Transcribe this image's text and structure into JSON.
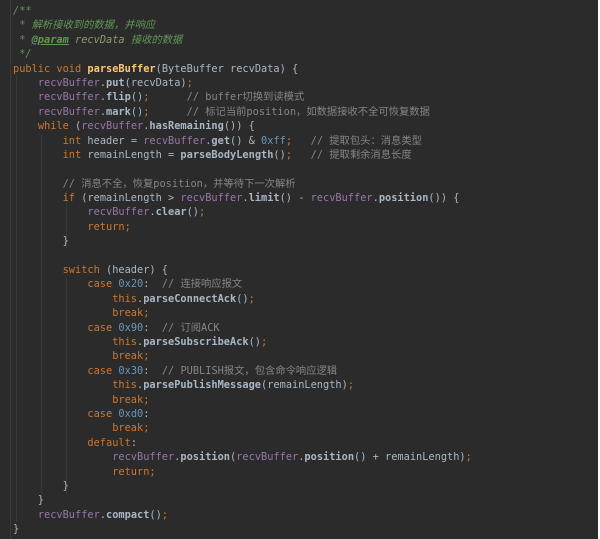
{
  "editor": {
    "palette": {
      "bg": "#2b2b2b",
      "gutterLine": "#3c3c3c",
      "guide": "#383838",
      "pln": "#a9b7c6",
      "kw": "#cc7832",
      "semi": "#cc7832",
      "meth": "#ffc66d",
      "call": "#a9b7c6",
      "field": "#9876aa",
      "num": "#6897bb",
      "cmt": "#858585",
      "doc": "#629755",
      "docval": "#8a9a70",
      "edge": "#ffffff"
    },
    "lines": [
      [
        [
          "doc",
          "/**"
        ]
      ],
      [
        [
          "doc",
          " * 解析接收到的数据，并响应"
        ]
      ],
      [
        [
          "doc",
          " * "
        ],
        [
          "doctag",
          "@param"
        ],
        [
          "doc",
          " "
        ],
        [
          "docval",
          "recvData"
        ],
        [
          "doc",
          " 接收的数据"
        ]
      ],
      [
        [
          "doc",
          " */"
        ]
      ],
      [
        [
          "kw",
          "public"
        ],
        [
          "pln",
          " "
        ],
        [
          "kw",
          "void"
        ],
        [
          "pln",
          " "
        ],
        [
          "meth",
          "parseBuffer"
        ],
        [
          "pln",
          "(ByteBuffer recvData) {"
        ]
      ],
      [
        [
          "pln",
          "    "
        ],
        [
          "field",
          "recvBuffer"
        ],
        [
          "pln",
          "."
        ],
        [
          "call",
          "put"
        ],
        [
          "pln",
          "(recvData)"
        ],
        [
          "semi",
          ";"
        ]
      ],
      [
        [
          "pln",
          "    "
        ],
        [
          "field",
          "recvBuffer"
        ],
        [
          "pln",
          "."
        ],
        [
          "call",
          "flip"
        ],
        [
          "pln",
          "()"
        ],
        [
          "semi",
          ";"
        ],
        [
          "pln",
          "      "
        ],
        [
          "cmt",
          "// buffer切换到读模式"
        ]
      ],
      [
        [
          "pln",
          "    "
        ],
        [
          "field",
          "recvBuffer"
        ],
        [
          "pln",
          "."
        ],
        [
          "call",
          "mark"
        ],
        [
          "pln",
          "()"
        ],
        [
          "semi",
          ";"
        ],
        [
          "pln",
          "      "
        ],
        [
          "cmt",
          "// 标记当前position，如数据接收不全可恢复数据"
        ]
      ],
      [
        [
          "pln",
          "    "
        ],
        [
          "kw",
          "while"
        ],
        [
          "pln",
          " ("
        ],
        [
          "field",
          "recvBuffer"
        ],
        [
          "pln",
          "."
        ],
        [
          "call",
          "hasRemaining"
        ],
        [
          "pln",
          "()) {"
        ]
      ],
      [
        [
          "pln",
          "        "
        ],
        [
          "kw",
          "int"
        ],
        [
          "pln",
          " header = "
        ],
        [
          "field",
          "recvBuffer"
        ],
        [
          "pln",
          "."
        ],
        [
          "call",
          "get"
        ],
        [
          "pln",
          "() & "
        ],
        [
          "num",
          "0xff"
        ],
        [
          "semi",
          ";"
        ],
        [
          "pln",
          "   "
        ],
        [
          "cmt",
          "// 提取包头：消息类型"
        ]
      ],
      [
        [
          "pln",
          "        "
        ],
        [
          "kw",
          "int"
        ],
        [
          "pln",
          " remainLength = "
        ],
        [
          "call",
          "parseBodyLength"
        ],
        [
          "pln",
          "()"
        ],
        [
          "semi",
          ";"
        ],
        [
          "pln",
          "   "
        ],
        [
          "cmt",
          "// 提取剩余消息长度"
        ]
      ],
      [],
      [
        [
          "pln",
          "        "
        ],
        [
          "cmt",
          "// 消息不全，恢复position，并等待下一次解析"
        ]
      ],
      [
        [
          "pln",
          "        "
        ],
        [
          "kw",
          "if"
        ],
        [
          "pln",
          " (remainLength > "
        ],
        [
          "field",
          "recvBuffer"
        ],
        [
          "pln",
          "."
        ],
        [
          "call",
          "limit"
        ],
        [
          "pln",
          "() - "
        ],
        [
          "field",
          "recvBuffer"
        ],
        [
          "pln",
          "."
        ],
        [
          "call",
          "position"
        ],
        [
          "pln",
          "()) {"
        ]
      ],
      [
        [
          "pln",
          "            "
        ],
        [
          "field",
          "recvBuffer"
        ],
        [
          "pln",
          "."
        ],
        [
          "call",
          "clear"
        ],
        [
          "pln",
          "()"
        ],
        [
          "semi",
          ";"
        ]
      ],
      [
        [
          "pln",
          "            "
        ],
        [
          "kw",
          "return"
        ],
        [
          "semi",
          ";"
        ]
      ],
      [
        [
          "pln",
          "        }"
        ]
      ],
      [],
      [
        [
          "pln",
          "        "
        ],
        [
          "kw",
          "switch"
        ],
        [
          "pln",
          " (header) {"
        ]
      ],
      [
        [
          "pln",
          "            "
        ],
        [
          "kw",
          "case"
        ],
        [
          "pln",
          " "
        ],
        [
          "num",
          "0x20"
        ],
        [
          "pln",
          ":  "
        ],
        [
          "cmt",
          "// 连接响应报文"
        ]
      ],
      [
        [
          "pln",
          "                "
        ],
        [
          "kw",
          "this"
        ],
        [
          "pln",
          "."
        ],
        [
          "call",
          "parseConnectAck"
        ],
        [
          "pln",
          "()"
        ],
        [
          "semi",
          ";"
        ]
      ],
      [
        [
          "pln",
          "                "
        ],
        [
          "kw",
          "break"
        ],
        [
          "semi",
          ";"
        ]
      ],
      [
        [
          "pln",
          "            "
        ],
        [
          "kw",
          "case"
        ],
        [
          "pln",
          " "
        ],
        [
          "num",
          "0x90"
        ],
        [
          "pln",
          ":  "
        ],
        [
          "cmt",
          "// 订阅ACK"
        ]
      ],
      [
        [
          "pln",
          "                "
        ],
        [
          "kw",
          "this"
        ],
        [
          "pln",
          "."
        ],
        [
          "call",
          "parseSubscribeAck"
        ],
        [
          "pln",
          "()"
        ],
        [
          "semi",
          ";"
        ]
      ],
      [
        [
          "pln",
          "                "
        ],
        [
          "kw",
          "break"
        ],
        [
          "semi",
          ";"
        ]
      ],
      [
        [
          "pln",
          "            "
        ],
        [
          "kw",
          "case"
        ],
        [
          "pln",
          " "
        ],
        [
          "num",
          "0x30"
        ],
        [
          "pln",
          ":  "
        ],
        [
          "cmt",
          "// PUBLISH报文，包含命令响应逻辑"
        ]
      ],
      [
        [
          "pln",
          "                "
        ],
        [
          "kw",
          "this"
        ],
        [
          "pln",
          "."
        ],
        [
          "call",
          "parsePublishMessage"
        ],
        [
          "pln",
          "(remainLength)"
        ],
        [
          "semi",
          ";"
        ]
      ],
      [
        [
          "pln",
          "                "
        ],
        [
          "kw",
          "break"
        ],
        [
          "semi",
          ";"
        ]
      ],
      [
        [
          "pln",
          "            "
        ],
        [
          "kw",
          "case"
        ],
        [
          "pln",
          " "
        ],
        [
          "num",
          "0xd0"
        ],
        [
          "pln",
          ":"
        ]
      ],
      [
        [
          "pln",
          "                "
        ],
        [
          "kw",
          "break"
        ],
        [
          "semi",
          ";"
        ]
      ],
      [
        [
          "pln",
          "            "
        ],
        [
          "kw",
          "default"
        ],
        [
          "pln",
          ":"
        ]
      ],
      [
        [
          "pln",
          "                "
        ],
        [
          "field",
          "recvBuffer"
        ],
        [
          "pln",
          "."
        ],
        [
          "call",
          "position"
        ],
        [
          "pln",
          "("
        ],
        [
          "field",
          "recvBuffer"
        ],
        [
          "pln",
          "."
        ],
        [
          "call",
          "position"
        ],
        [
          "pln",
          "() + remainLength)"
        ],
        [
          "semi",
          ";"
        ]
      ],
      [
        [
          "pln",
          "                "
        ],
        [
          "kw",
          "return"
        ],
        [
          "semi",
          ";"
        ]
      ],
      [
        [
          "pln",
          "        }"
        ]
      ],
      [
        [
          "pln",
          "    }"
        ]
      ],
      [
        [
          "pln",
          "    "
        ],
        [
          "field",
          "recvBuffer"
        ],
        [
          "pln",
          "."
        ],
        [
          "call",
          "compact"
        ],
        [
          "pln",
          "()"
        ],
        [
          "semi",
          ";"
        ]
      ],
      [
        [
          "pln",
          "}"
        ]
      ]
    ]
  }
}
